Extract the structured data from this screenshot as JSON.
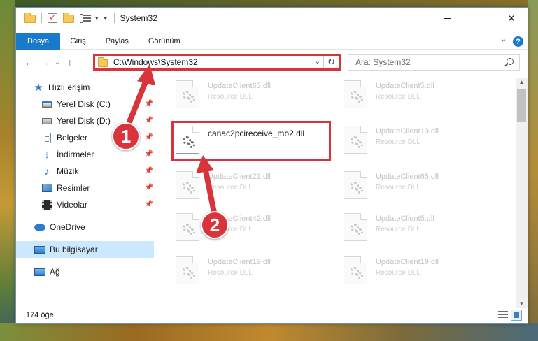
{
  "window": {
    "title": "System32",
    "controls": {
      "minimize": "",
      "maximize": "",
      "close": "✕"
    }
  },
  "ribbon": {
    "tabs": [
      "Dosya",
      "Giriş",
      "Paylaş",
      "Görünüm"
    ],
    "help": "?"
  },
  "address_bar": {
    "path": "C:\\Windows\\System32",
    "refresh": "↻",
    "dropdown": "⌄"
  },
  "search": {
    "placeholder": "Ara: System32"
  },
  "nav_buttons": {
    "back": "←",
    "forward": "→",
    "history": "⌄",
    "up": "↑"
  },
  "nav_pane": {
    "items": [
      {
        "label": "Hızlı erişim",
        "icon": "star-icon"
      },
      {
        "label": "Yerel Disk (C:)",
        "icon": "drive-icon",
        "pinned": true
      },
      {
        "label": "Yerel Disk (D:)",
        "icon": "drive-icon",
        "pinned": true
      },
      {
        "label": "Belgeler",
        "icon": "document-icon",
        "pinned": true
      },
      {
        "label": "İndirmeler",
        "icon": "download-icon",
        "pinned": true
      },
      {
        "label": "Müzik",
        "icon": "music-icon",
        "pinned": true
      },
      {
        "label": "Resimler",
        "icon": "pictures-icon",
        "pinned": true
      },
      {
        "label": "Videolar",
        "icon": "video-icon",
        "pinned": true
      },
      {
        "label": "OneDrive",
        "icon": "cloud-icon"
      },
      {
        "label": "Bu bilgisayar",
        "icon": "computer-icon",
        "selected": true
      },
      {
        "label": "Ağ",
        "icon": "network-icon"
      }
    ],
    "pin_glyph": "📌"
  },
  "files": [
    {
      "name": "UpdateClient63.dll",
      "type": "Resource DLL"
    },
    {
      "name": "UpdateClient5.dll",
      "type": "Resource DLL"
    },
    {
      "name": "canac2pcireceive_mb2.dll",
      "type": "",
      "highlighted": true
    },
    {
      "name": "UpdateClient19.dll",
      "type": "Resource DLL"
    },
    {
      "name": "UpdateClient21.dll",
      "type": "Resource DLL"
    },
    {
      "name": "UpdateClient65.dll",
      "type": "Resource DLL"
    },
    {
      "name": "UpdateClient42.dll",
      "type": "Resource DLL"
    },
    {
      "name": "UpdateClient5.dll",
      "type": "Resource DLL"
    },
    {
      "name": "UpdateClient19.dll",
      "type": "Resource DLL"
    },
    {
      "name": "UpdateClient19.dll",
      "type": "Resource DLL"
    }
  ],
  "status": {
    "item_count": "174 öğe"
  },
  "annotations": {
    "step1": "1",
    "step2": "2",
    "color": "#d9343b"
  },
  "colors": {
    "accent": "#1979ca",
    "selection": "#cce8ff",
    "highlight": "#d9343b"
  }
}
